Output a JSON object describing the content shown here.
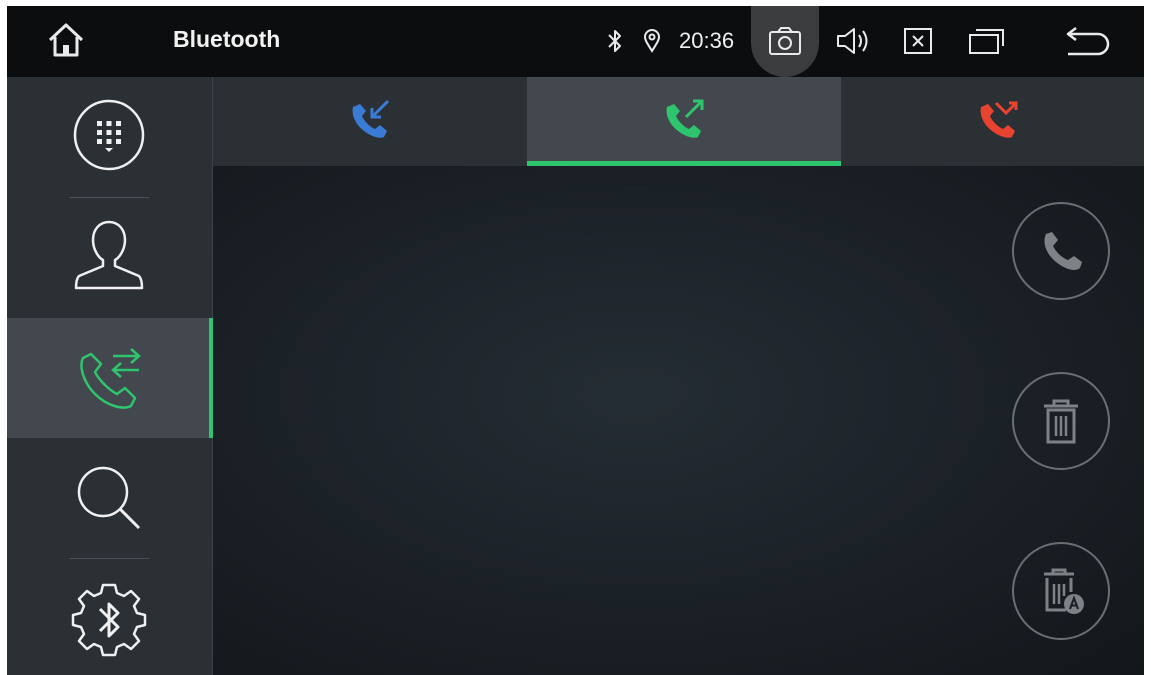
{
  "statusbar": {
    "title": "Bluetooth",
    "time": "20:36",
    "icons": [
      "home-icon",
      "bluetooth-icon",
      "location-pin-icon",
      "camera-icon",
      "volume-icon",
      "close-box-icon",
      "recent-apps-icon",
      "back-icon"
    ]
  },
  "sidebar": {
    "items": [
      {
        "icon": "dialpad-icon",
        "active": false
      },
      {
        "icon": "contacts-icon",
        "active": false
      },
      {
        "icon": "call-history-icon",
        "active": true
      },
      {
        "icon": "search-icon",
        "active": false
      },
      {
        "icon": "bluetooth-settings-icon",
        "active": false
      }
    ]
  },
  "tabs": [
    {
      "icon": "incoming-call-icon",
      "color": "#3a7bd5",
      "active": false
    },
    {
      "icon": "outgoing-call-icon",
      "color": "#2fc46e",
      "active": true
    },
    {
      "icon": "missed-call-icon",
      "color": "#e8432f",
      "active": false
    }
  ],
  "actions": [
    "call-button",
    "delete-button",
    "delete-all-button"
  ],
  "colors": {
    "accent": "#2fc46e",
    "incoming": "#3a7bd5",
    "outgoing": "#2fc46e",
    "missed": "#e8432f"
  }
}
